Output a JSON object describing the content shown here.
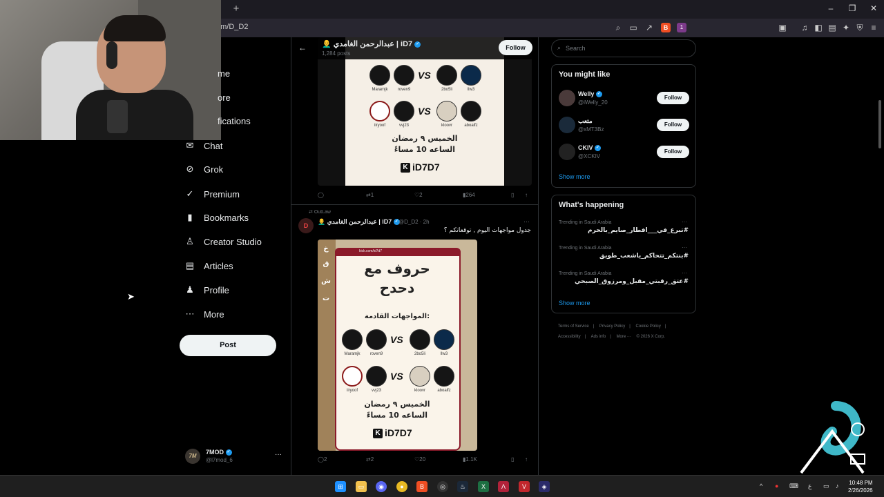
{
  "browser": {
    "new_tab": "+",
    "url": "om/D_D2",
    "window_controls": [
      "–",
      "❐",
      "✕"
    ],
    "brave_badge": "B",
    "ext_badge": "1"
  },
  "nav": {
    "items": [
      {
        "label": "me",
        "icon": "home-icon"
      },
      {
        "label": "ore",
        "icon": "explore-icon"
      },
      {
        "label": "fications",
        "icon": "bell-icon"
      },
      {
        "label": "Chat",
        "icon": "mail-icon",
        "glyph": "✉"
      },
      {
        "label": "Grok",
        "icon": "grok-icon",
        "glyph": "⊘"
      },
      {
        "label": "Premium",
        "icon": "premium-icon",
        "glyph": "✓"
      },
      {
        "label": "Bookmarks",
        "icon": "bookmark-icon",
        "glyph": "🔖"
      },
      {
        "label": "Creator Studio",
        "icon": "creator-icon",
        "glyph": "♙"
      },
      {
        "label": "Articles",
        "icon": "articles-icon",
        "glyph": "▤"
      },
      {
        "label": "Profile",
        "icon": "profile-icon",
        "glyph": "♟"
      },
      {
        "label": "More",
        "icon": "more-icon",
        "glyph": "⋯"
      }
    ],
    "post_label": "Post",
    "profile": {
      "avatar": "7M",
      "name": "7MOD",
      "handle": "@l7mod_6",
      "dots": "···"
    }
  },
  "header": {
    "title": "👨‍🦲 عبدالرحمن الغامدي | iD7",
    "sub": "1,284 posts",
    "follow_label": "Follow",
    "back": "←"
  },
  "poster1": {
    "row1": [
      "Maramjk",
      "roven9",
      "2bo5li",
      "llw3"
    ],
    "row2": [
      "iiryoof",
      "vvj23",
      "kloovr",
      "aboalfz"
    ],
    "vs": "VS",
    "date_line1": "الخميس ٩ رمضان",
    "date_line2": "الساعه 10 مساءً",
    "kick": "iD7D7"
  },
  "tweet1_actions": {
    "reply": "",
    "repost": "1",
    "like": "2",
    "views": "264"
  },
  "tweet2": {
    "reposted_by": "OutLaw",
    "avatar": "D",
    "name": "👨‍🦲 عبدالرحمن الغامدي | iD7",
    "handle": "@D_D2 · 2h",
    "text": "جدول مواجهات اليوم , توقعاتكم ؟",
    "more": "···"
  },
  "poster2": {
    "url_bar": "kick.com/id7d7",
    "title_line1": "حروف مع",
    "title_line2": "دحدح",
    "subtitle": "المواجهات القادمة:",
    "side_letters": [
      "خ",
      "ق",
      "ش",
      "ت"
    ],
    "row1": [
      "Maramjk",
      "roven9",
      "2bo5li",
      "llw3"
    ],
    "row2": [
      "iiryoof",
      "vvj23",
      "kloovr",
      "aboalfz"
    ],
    "vs": "VS",
    "date_line1": "الخميس ٩ رمضان",
    "date_line2": "الساعه 10 مساءً",
    "kick": "iD7D7"
  },
  "tweet2_actions": {
    "reply": "2",
    "repost": "2",
    "like": "20",
    "views": "1.1K"
  },
  "right": {
    "search_placeholder": "Search",
    "might_like_title": "You might like",
    "suggestions": [
      {
        "name": "Welly",
        "handle": "@iWelly_20",
        "verified": true,
        "follow": "Follow"
      },
      {
        "name": "متعب",
        "handle": "@xMT3Bz",
        "verified": false,
        "follow": "Follow"
      },
      {
        "name": "CKIV",
        "handle": "@XCKIV",
        "verified": true,
        "follow": "Follow"
      }
    ],
    "show_more": "Show more",
    "happening_title": "What's happening",
    "trends": [
      {
        "category": "Trending in Saudi Arabia",
        "tag": "#تبرع_في___افطار_صايم_بالحرم"
      },
      {
        "category": "Trending in Saudi Arabia",
        "tag": "#بنتكم_تتحاكم_ياشعب_طويق"
      },
      {
        "category": "Trending in Saudi Arabia",
        "tag": "#عتق_رقبتي_مقبل_ومرزوق_الصبحي"
      }
    ],
    "show_more_2": "Show more",
    "footer": [
      "Terms of Service",
      "|",
      "Privacy Policy",
      "|",
      "Cookie Policy",
      "|",
      "Accessibility",
      "|",
      "Ads info",
      "|",
      "More ···",
      "© 2026 X Corp."
    ]
  },
  "taskbar": {
    "time": "10:48 PM",
    "date": "2/26/2026",
    "lang": "ع"
  },
  "colors": {
    "accent": "#1d9bf0",
    "bg": "#000000",
    "border": "#2f3336"
  }
}
